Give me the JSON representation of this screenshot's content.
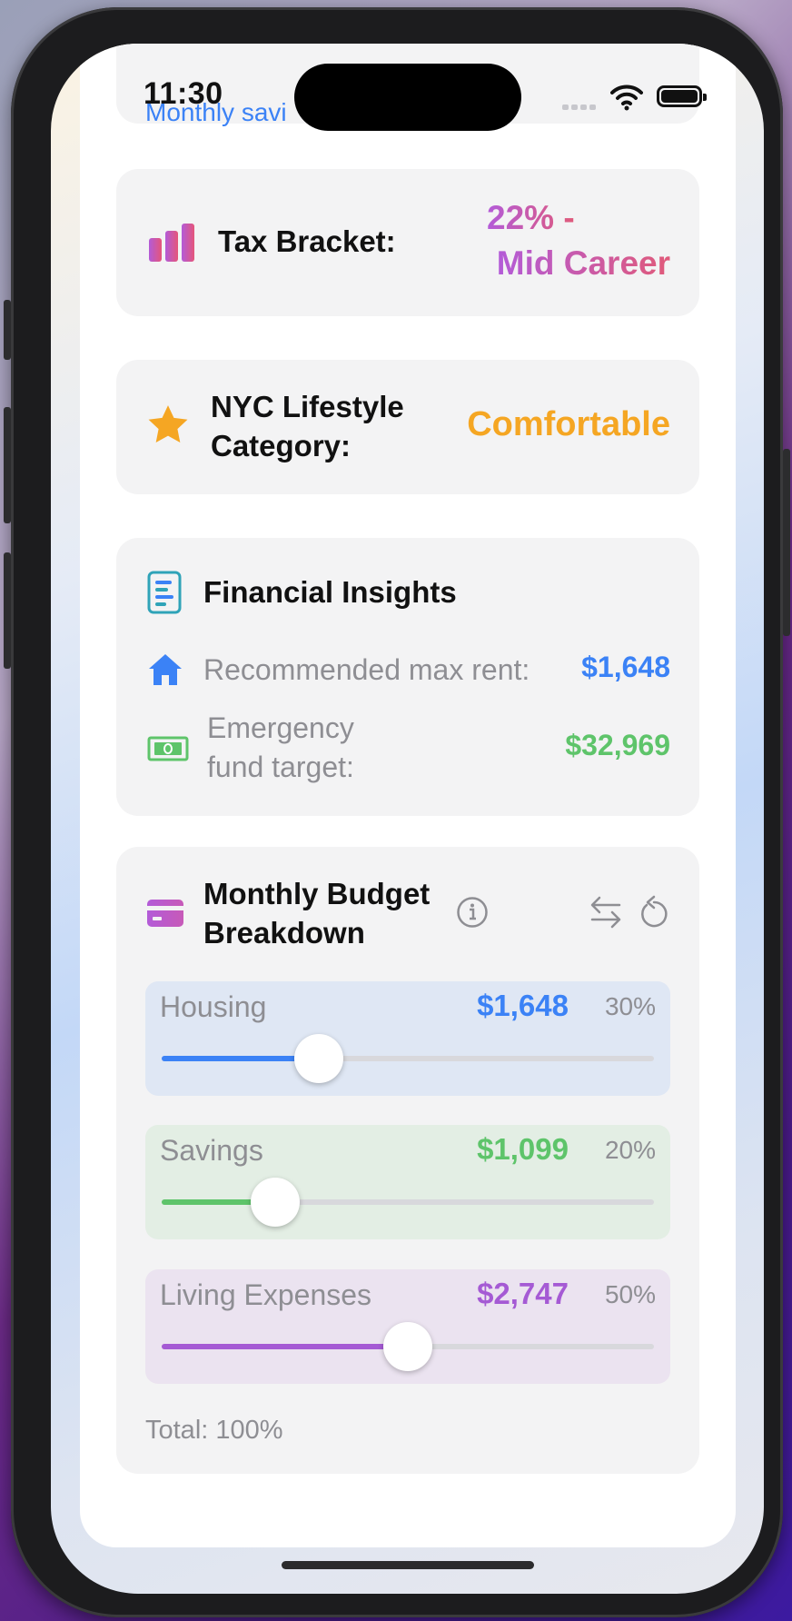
{
  "status_bar": {
    "time": "11:30"
  },
  "peek": {
    "link_text": "Monthly savi"
  },
  "tax": {
    "label": "Tax Bracket:",
    "value_line1": "22% -",
    "value_line2": "Mid Career"
  },
  "lifestyle": {
    "label_line1": "NYC Lifestyle",
    "label_line2": "Category:",
    "value": "Comfortable"
  },
  "insights": {
    "title": "Financial Insights",
    "rent_label": "Recommended max rent:",
    "rent_value": "$1,648",
    "emergency_label_line1": "Emergency",
    "emergency_label_line2": "fund target:",
    "emergency_value": "$32,969"
  },
  "budget": {
    "title_line1": "Monthly Budget",
    "title_line2": "Breakdown",
    "items": [
      {
        "name": "Housing",
        "amount": "$1,648",
        "percent": "30%",
        "level": 0.32,
        "color": "#3b82f6",
        "bg": "#dfe7f4"
      },
      {
        "name": "Savings",
        "amount": "$1,099",
        "percent": "20%",
        "level": 0.23,
        "color": "#5ec46a",
        "bg": "#e3eee4"
      },
      {
        "name": "Living Expenses",
        "amount": "$2,747",
        "percent": "50%",
        "level": 0.5,
        "color": "#a55ad4",
        "bg": "#ebe3f0"
      }
    ],
    "total": "Total: 100%"
  },
  "icons": {
    "tax": "bar-chart-icon",
    "lifestyle": "star-icon",
    "insights": "document-icon",
    "rent": "house-icon",
    "emergency": "money-icon",
    "budget": "credit-card-icon",
    "info": "info-icon",
    "swap": "swap-arrows-icon",
    "reset": "reset-icon"
  },
  "colors": {
    "blue": "#3b82f6",
    "green": "#5ec46a",
    "purple": "#a55ad4",
    "orange": "#f5a623",
    "pink": "#e05a7a"
  }
}
